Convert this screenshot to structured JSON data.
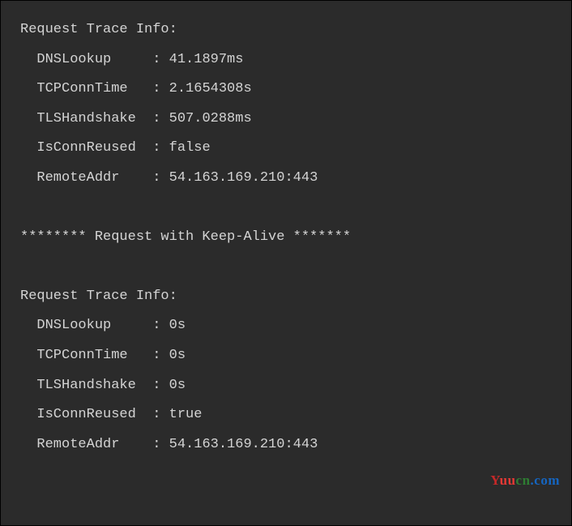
{
  "trace1": {
    "heading": "Request Trace Info:",
    "rows": [
      {
        "label": "  DNSLookup    ",
        "sep": " : ",
        "value": "41.1897ms"
      },
      {
        "label": "  TCPConnTime  ",
        "sep": " : ",
        "value": "2.1654308s"
      },
      {
        "label": "  TLSHandshake ",
        "sep": " : ",
        "value": "507.0288ms"
      },
      {
        "label": "  IsConnReused ",
        "sep": " : ",
        "value": "false"
      },
      {
        "label": "  RemoteAddr   ",
        "sep": " : ",
        "value": "54.163.169.210:443"
      }
    ]
  },
  "separator": "******** Request with Keep-Alive *******",
  "trace2": {
    "heading": "Request Trace Info:",
    "rows": [
      {
        "label": "  DNSLookup    ",
        "sep": " : ",
        "value": "0s"
      },
      {
        "label": "  TCPConnTime  ",
        "sep": " : ",
        "value": "0s"
      },
      {
        "label": "  TLSHandshake ",
        "sep": " : ",
        "value": "0s"
      },
      {
        "label": "  IsConnReused ",
        "sep": " : ",
        "value": "true"
      },
      {
        "label": "  RemoteAddr   ",
        "sep": " : ",
        "value": "54.163.169.210:443"
      }
    ]
  },
  "watermark": {
    "y": "Y",
    "uu": "uu",
    "cn": "cn",
    "com": ".com"
  }
}
